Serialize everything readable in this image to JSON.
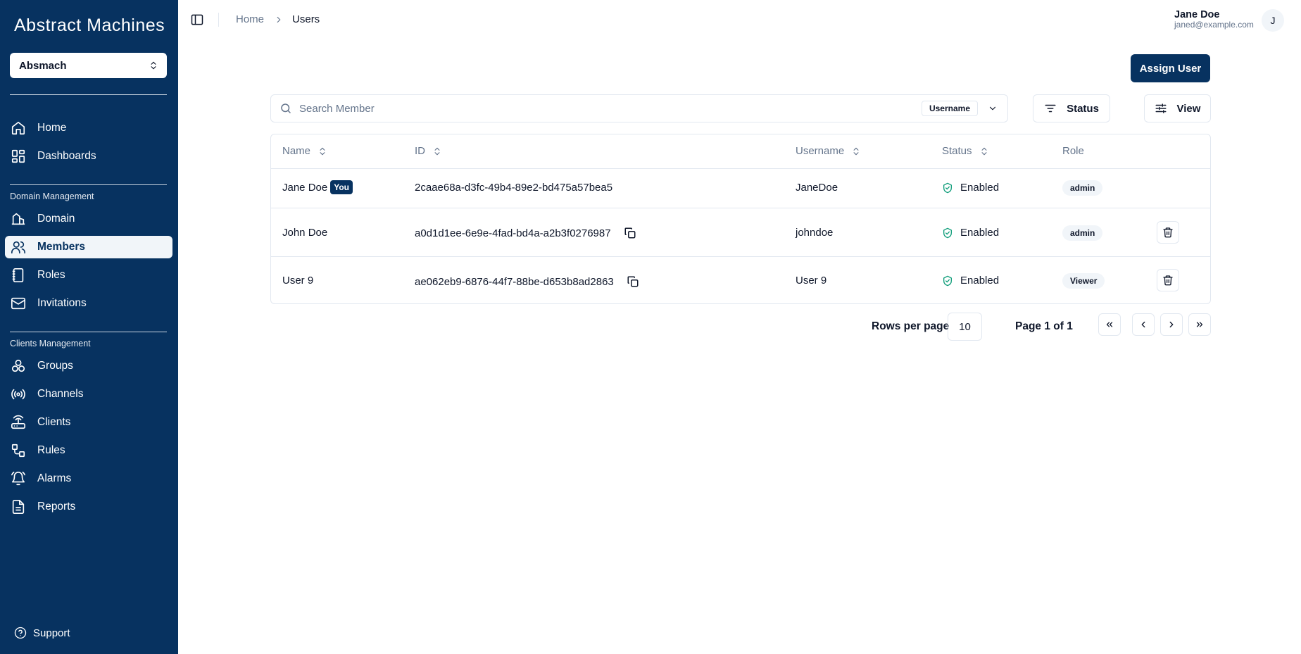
{
  "app": {
    "logo_text": "Abstract Machines"
  },
  "org_switcher": {
    "value": "Absmach"
  },
  "sidebar": {
    "primary": [
      {
        "label": "Home",
        "icon": "home-icon"
      },
      {
        "label": "Dashboards",
        "icon": "dashboard-icon"
      }
    ],
    "domain_section": {
      "label": "Domain Management",
      "items": [
        {
          "label": "Domain",
          "icon": "domain-icon"
        },
        {
          "label": "Members",
          "icon": "members-icon",
          "active": true
        },
        {
          "label": "Roles",
          "icon": "roles-icon"
        },
        {
          "label": "Invitations",
          "icon": "mail-icon"
        }
      ]
    },
    "clients_section": {
      "label": "Clients Management",
      "items": [
        {
          "label": "Groups",
          "icon": "groups-icon"
        },
        {
          "label": "Channels",
          "icon": "channels-icon"
        },
        {
          "label": "Clients",
          "icon": "clients-icon"
        },
        {
          "label": "Rules",
          "icon": "rules-icon"
        },
        {
          "label": "Alarms",
          "icon": "alarm-icon"
        },
        {
          "label": "Reports",
          "icon": "reports-icon"
        }
      ]
    },
    "support_label": "Support"
  },
  "header": {
    "breadcrumb": [
      "Home",
      "Users"
    ],
    "user": {
      "name": "Jane Doe",
      "email": "janed@example.com",
      "initial": "J"
    }
  },
  "toolbar": {
    "assign_label": "Assign User",
    "search_placeholder": "Search Member",
    "search_field": "Username",
    "status_label": "Status",
    "view_label": "View"
  },
  "table": {
    "headers": [
      "Name",
      "ID",
      "Username",
      "Status",
      "Role"
    ],
    "rows": [
      {
        "name": "Jane Doe",
        "you": "You",
        "id": "2caae68a-d3fc-49b4-89e2-bd475a57bea5",
        "username": "JaneDoe",
        "status": "Enabled",
        "role": "admin"
      },
      {
        "name": "John Doe",
        "id": "a0d1d1ee-6e9e-4fad-bd4a-a2b3f0276987",
        "username": "johndoe",
        "status": "Enabled",
        "role": "admin"
      },
      {
        "name": "User 9",
        "id": "ae062eb9-6876-44f7-88be-d653b8ad2863",
        "username": "User 9",
        "status": "Enabled",
        "role": "Viewer"
      }
    ]
  },
  "pagination": {
    "rows_per_page_label": "Rows per page",
    "rows_per_page": "10",
    "page_label": "Page 1 of 1"
  },
  "colors": {
    "brand": "#073260",
    "status_ok": "#0f9d7a",
    "border": "#e2e8f0",
    "muted_text": "#64748b"
  }
}
